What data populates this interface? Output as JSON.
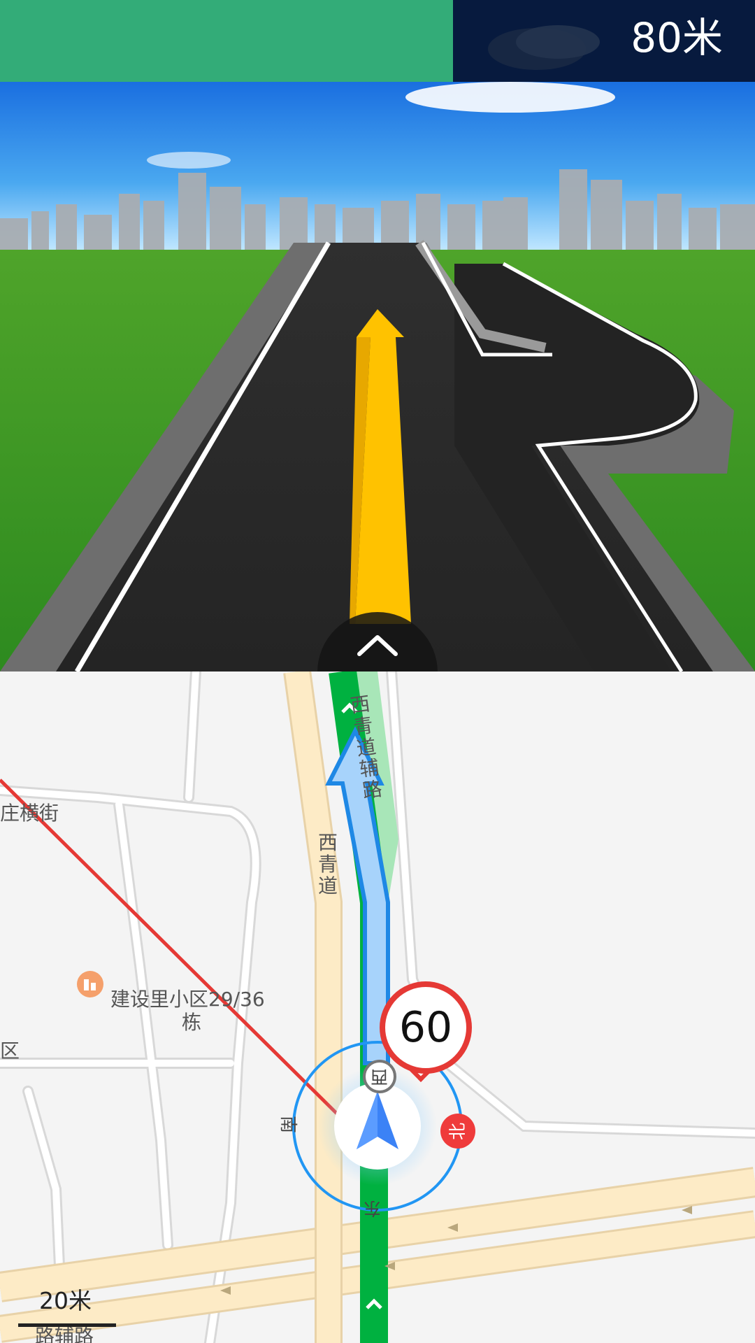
{
  "guidance": {
    "distance": "80米"
  },
  "map": {
    "streets": {
      "zhuang_heng_jie": "庄横街",
      "xiqingdao_side": "西青道辅路",
      "xiqingdao": "西青道",
      "lu_fu_lu": "路辅路"
    },
    "poi": {
      "name": "建设里小区29/36",
      "name_line2": "栋",
      "edge_label": "区"
    },
    "speed_limit": "60",
    "compass": {
      "north": "北",
      "south": "南",
      "east": "东",
      "west": "西"
    },
    "scale": "20米"
  },
  "colors": {
    "progress": "#33ac78",
    "route": "#1e88e5",
    "lane": "#00b140",
    "speed_limit": "#e53935",
    "guide_arrow": "#ffc200"
  },
  "icons": {
    "collapse": "chevron-up-icon",
    "poi": "building-icon",
    "vehicle": "navigation-arrow-icon"
  }
}
